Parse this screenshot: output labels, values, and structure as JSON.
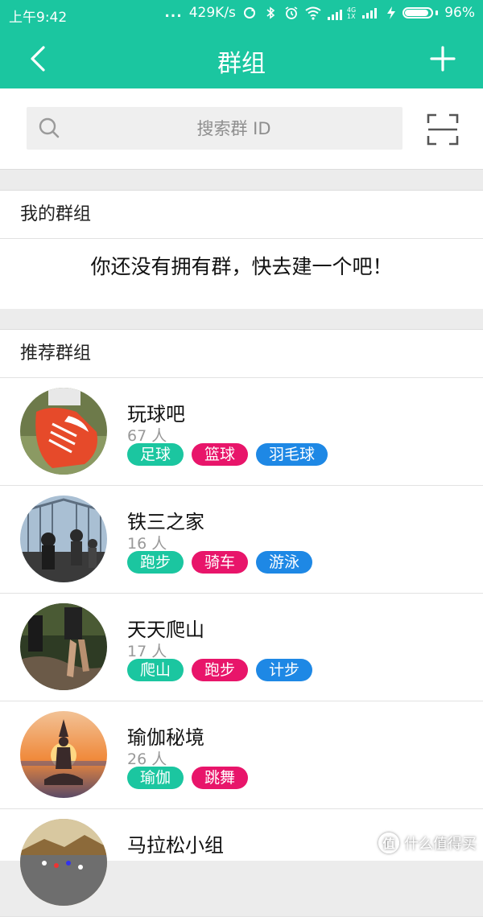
{
  "status_bar": {
    "time": "上午9:42",
    "dots": "...",
    "speed": "429K/s",
    "network_label": "4G",
    "network_sub": "1X",
    "battery": "96%"
  },
  "header": {
    "title": "群组",
    "back_icon": "chevron-left-icon",
    "add_icon": "plus-icon"
  },
  "search": {
    "placeholder": "搜索群 ID",
    "value": "",
    "search_icon": "search-icon",
    "scan_icon": "scan-icon"
  },
  "my_groups": {
    "header": "我的群组",
    "empty_message": "你还没有拥有群，快去建一个吧！"
  },
  "recommended": {
    "header": "推荐群组",
    "groups": [
      {
        "name": "玩球吧",
        "count": "67 人",
        "tags": [
          "足球",
          "篮球",
          "羽毛球"
        ]
      },
      {
        "name": "铁三之家",
        "count": "16 人",
        "tags": [
          "跑步",
          "骑车",
          "游泳"
        ]
      },
      {
        "name": "天天爬山",
        "count": "17 人",
        "tags": [
          "爬山",
          "跑步",
          "计步"
        ]
      },
      {
        "name": "瑜伽秘境",
        "count": "26 人",
        "tags": [
          "瑜伽",
          "跳舞"
        ]
      },
      {
        "name": "马拉松小组",
        "count": "",
        "tags": []
      }
    ]
  },
  "colors": {
    "brand": "#1bc6a0",
    "tag_green": "#1bc6a0",
    "tag_pink": "#e8156a",
    "tag_blue": "#1e88e5"
  },
  "watermark": {
    "logo": "值",
    "text": "什么值得买"
  }
}
